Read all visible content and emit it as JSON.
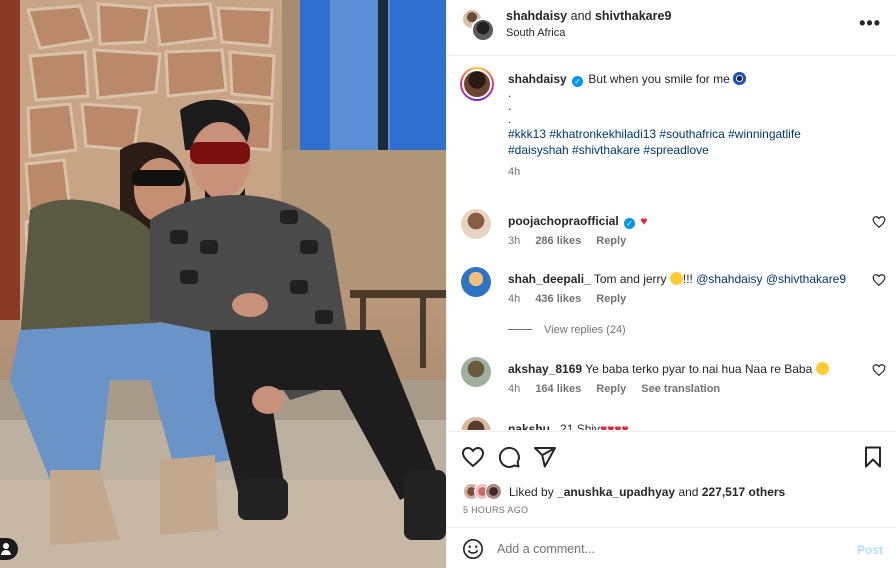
{
  "post": {
    "header": {
      "user1": "shahdaisy",
      "conjunction": "and",
      "user2": "shivthakare9",
      "location": "South Africa",
      "more_icon": "more-horizontal-icon"
    },
    "caption": {
      "username": "shahdaisy",
      "text": "But when you smile for me",
      "dots": [
        ".",
        ".",
        "."
      ],
      "hashtags_line1": "#kkk13 #khatronkekhiladi13 #southafrica #winningatlife",
      "hashtags_line2": "#daisyshah #shivthakare #spreadlove",
      "time": "4h"
    },
    "comments": [
      {
        "username": "poojachopraofficial",
        "verified": true,
        "text": "",
        "emoji": "♥",
        "time": "3h",
        "likes": "286 likes",
        "reply": "Reply"
      },
      {
        "username": "shah_deepali_",
        "text": "Tom and jerry",
        "text_suffix": "!!!",
        "mention1": "@shahdaisy",
        "mention2": "@shivthakare9",
        "time": "4h",
        "likes": "436 likes",
        "reply": "Reply",
        "view_replies": "View replies (24)"
      },
      {
        "username": "akshay_8169",
        "text": "Ye baba terko pyar to nai hua Naa re Baba",
        "time": "4h",
        "likes": "164 likes",
        "reply": "Reply",
        "translation": "See translation"
      },
      {
        "username": "nakshu_",
        "text": "21 Shiv",
        "hearts": "♥♥♥♥"
      }
    ],
    "actions": {
      "icons": [
        "heart-icon",
        "comment-icon",
        "share-icon",
        "bookmark-icon"
      ],
      "liked_by_prefix": "Liked by",
      "liked_by_user": "_anushka_upadhyay",
      "liked_by_and": "and",
      "liked_by_count": "227,517 others",
      "time_ago": "5 HOURS AGO"
    },
    "add_comment": {
      "placeholder": "Add a comment...",
      "post_label": "Post"
    },
    "colors": {
      "link": "#00376b",
      "verified": "#0095f6",
      "heart": "#ed1c3b",
      "post_button_disabled": "#b2dffc",
      "meta": "#737373"
    }
  }
}
